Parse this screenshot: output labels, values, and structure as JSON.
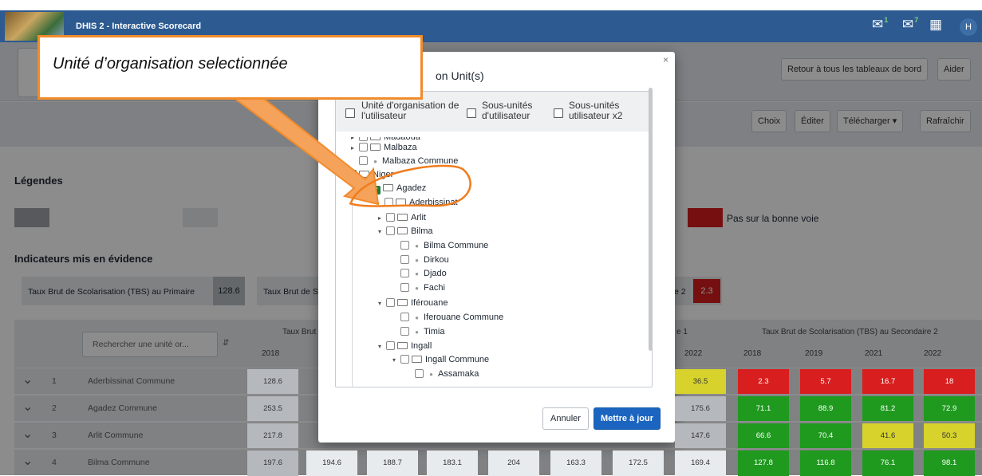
{
  "app": {
    "title": "DHIS 2 - Interactive Scorecard",
    "user_initial": "H",
    "messages_badge": "1",
    "email_badge": "7"
  },
  "header": {
    "back_button": "Retour à tous les tableaux de bord",
    "help_button": "Aider"
  },
  "toolbar": {
    "options": "Choix",
    "edit": "Éditer",
    "download": "Télécharger",
    "refresh": "Rafraîchir"
  },
  "legend": {
    "title": "Légendes",
    "red_label": "Pas sur la bonne voie"
  },
  "highlights": {
    "title": "Indicateurs mis en évidence",
    "card1_label": "Taux Brut de Scolarisation (TBS) au Primaire",
    "card1_value": "128.6",
    "card2_label": "Taux Brut de S",
    "card3_label": "e 2",
    "card3_value": "2.3"
  },
  "table": {
    "search_placeholder": "Rechercher une unité or...",
    "group1": "Taux Brut",
    "group3": "e 1",
    "group4": "Taux Brut de Scolarisation (TBS) au Secondaire 2",
    "years": [
      "2018",
      "2022",
      "2018",
      "2019",
      "2021",
      "2022"
    ],
    "rows": [
      {
        "num": "1",
        "name": "Aderbissinat Commune",
        "cells": [
          "128.6",
          "36.5",
          "2.3",
          "5.7",
          "16.7",
          "18"
        ]
      },
      {
        "num": "2",
        "name": "Agadez Commune",
        "cells": [
          "253.5",
          "175.6",
          "71.1",
          "88.9",
          "81.2",
          "72.9"
        ]
      },
      {
        "num": "3",
        "name": "Arlit Commune",
        "cells": [
          "217.8",
          "147.6",
          "66.6",
          "70.4",
          "41.6",
          "50.3"
        ]
      },
      {
        "num": "4",
        "name": "Bilma Commune",
        "cells": [
          "197.6",
          "194.6",
          "188.7",
          "183.1",
          "204",
          "163.3",
          "172.5",
          "169.4",
          "127.8",
          "116.8",
          "76.1",
          "98.1"
        ]
      }
    ],
    "colors": {
      "grey": "#b5b9be",
      "yellow": "#d7d32c",
      "green": "#1f9a1f",
      "red": "#d81e1e"
    }
  },
  "modal": {
    "title": "on Unit(s)",
    "close": "×",
    "user_org": "Unité d'organisation de l'utilisateur",
    "sub_units": "Sous-unités d'utilisateur",
    "sub_units_x2": "Sous-unités utilisateur x2",
    "tree": [
      "Madaoua",
      "Malbaza",
      "Malbaza Commune",
      "Niger",
      "Agadez",
      "Aderbissinat",
      "Arlit",
      "Bilma",
      "Bilma Commune",
      "Dirkou",
      "Djado",
      "Fachi",
      "Iférouane",
      "Iferouane Commune",
      "Timia",
      "Ingall",
      "Ingall Commune",
      "Assamaka"
    ],
    "cancel": "Annuler",
    "update": "Mettre à jour"
  },
  "annotation": {
    "callout_text": "Unité d’organisation selectionnée",
    "accent": "#f28b2b"
  }
}
